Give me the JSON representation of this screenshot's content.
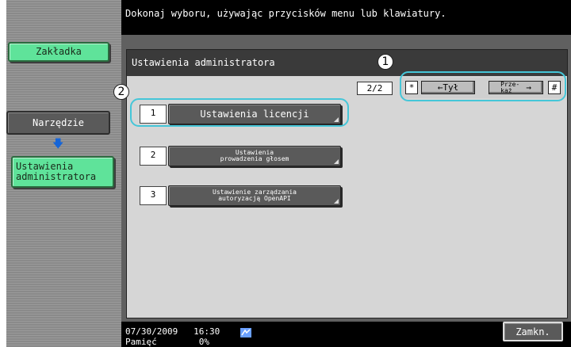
{
  "header": {
    "message": "Dokonaj wyboru, używając przycisków menu lub klawiatury."
  },
  "sidebar": {
    "tab_label": "Zakładka",
    "tool_label": "Narzędzie",
    "current_label": "Ustawienia\nadministratora"
  },
  "panel": {
    "title": "Ustawienia administratora",
    "page": "2/2",
    "nav": {
      "star": "*",
      "back": "Tył",
      "forward_line1": "Prze-",
      "forward_line2": "każ",
      "hash": "#"
    },
    "items": [
      {
        "num": "1",
        "label": "Ustawienia licencji"
      },
      {
        "num": "2",
        "label": "Ustawienia\nprowadzenia głosem"
      },
      {
        "num": "3",
        "label": "Ustawienie zarządzania\nautoryzacją OpenAPI"
      }
    ]
  },
  "callouts": {
    "one": "1",
    "two": "2"
  },
  "footer": {
    "datetime": "07/30/2009   16:30",
    "memory": "Pamięć        0%",
    "close_label": "Zamkn."
  },
  "colors": {
    "accent_green": "#5fe39a",
    "callout": "#45c6d8",
    "arrow_blue": "#1565d8"
  },
  "icons": {
    "arrow": "arrow-down-icon",
    "network": "network-status-icon"
  }
}
